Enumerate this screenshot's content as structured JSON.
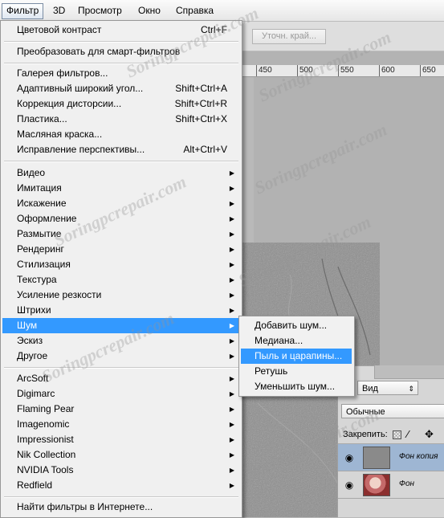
{
  "menubar": {
    "items": [
      "Фильтр",
      "3D",
      "Просмотр",
      "Окно",
      "Справка"
    ]
  },
  "options_bar": {
    "refine_edge_button": "Уточн. край..."
  },
  "ruler": {
    "labels": [
      "450",
      "500",
      "550",
      "600",
      "650"
    ]
  },
  "filter_menu": {
    "top_items": [
      {
        "label": "Цветовой контраст",
        "shortcut": "Ctrl+F"
      },
      {
        "label": "Преобразовать для смарт-фильтров",
        "shortcut": ""
      }
    ],
    "gallery_items": [
      {
        "label": "Галерея фильтров...",
        "shortcut": ""
      },
      {
        "label": "Адаптивный широкий угол...",
        "shortcut": "Shift+Ctrl+A"
      },
      {
        "label": "Коррекция дисторсии...",
        "shortcut": "Shift+Ctrl+R"
      },
      {
        "label": "Пластика...",
        "shortcut": "Shift+Ctrl+X"
      },
      {
        "label": "Масляная краска...",
        "shortcut": ""
      },
      {
        "label": "Исправление перспективы...",
        "shortcut": "Alt+Ctrl+V"
      }
    ],
    "category_items": [
      "Видео",
      "Имитация",
      "Искажение",
      "Оформление",
      "Размытие",
      "Рендеринг",
      "Стилизация",
      "Текстура",
      "Усиление резкости",
      "Штрихи",
      "Шум",
      "Эскиз",
      "Другое"
    ],
    "highlighted_category": "Шум",
    "plugin_items": [
      "ArcSoft",
      "Digimarc",
      "Flaming Pear",
      "Imagenomic",
      "Impressionist",
      "Nik Collection",
      "NVIDIA Tools",
      "Redfield"
    ],
    "online_item": "Найти фильтры в Интернете..."
  },
  "noise_submenu": {
    "items": [
      "Добавить шум...",
      "Медиана...",
      "Пыль и царапины...",
      "Ретушь",
      "Уменьшить шум..."
    ],
    "highlighted": "Пыль и царапины..."
  },
  "layers_panel": {
    "tab_label": "ои",
    "filter_dropdown": "Вид",
    "blend_mode": "Обычные",
    "lock_label": "Закрепить:",
    "layers": [
      {
        "name": "Фон копия",
        "selected": true
      },
      {
        "name": "Фон",
        "selected": false
      }
    ]
  },
  "watermark": "Soringpcrepair.com"
}
